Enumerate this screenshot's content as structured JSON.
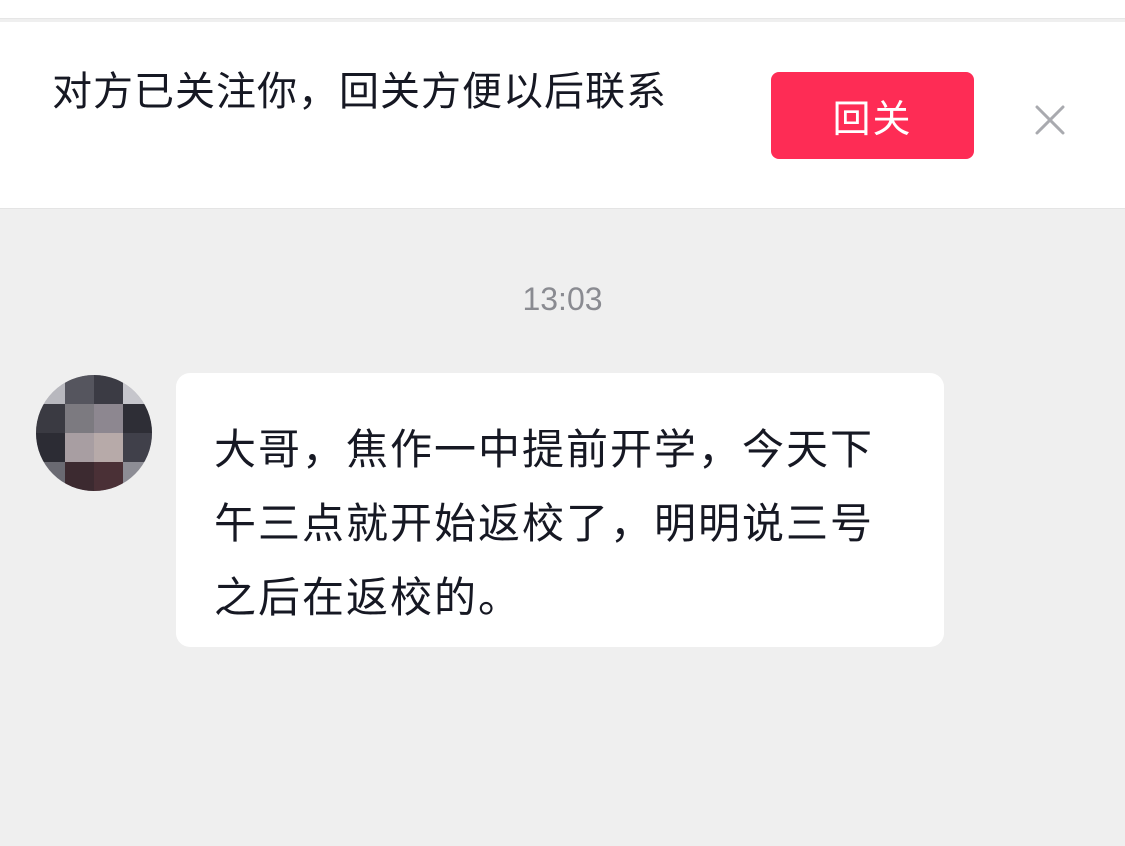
{
  "banner": {
    "text": "对方已关注你，回关方便以后联系",
    "follow_back_label": "回关",
    "close_icon": "close-icon"
  },
  "chat": {
    "timestamp": "13:03",
    "message": {
      "sender_avatar": "pixelated-avatar",
      "text": "大哥，焦作一中提前开学，今天下午三点就开始返校了，明明说三号之后在返校的。"
    }
  },
  "colors": {
    "accent": "#fe2c55",
    "background": "#efefef",
    "bubble": "#ffffff",
    "timestamp": "#8a8b91"
  }
}
